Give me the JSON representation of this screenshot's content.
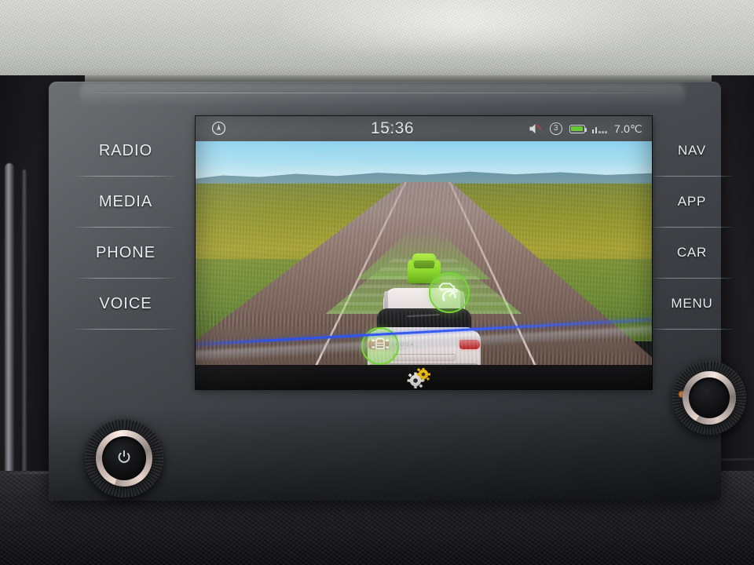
{
  "device": {
    "name": "Car infotainment head unit",
    "brand_hint": "Skoda"
  },
  "left_buttons": [
    {
      "label": "RADIO",
      "name": "radio"
    },
    {
      "label": "MEDIA",
      "name": "media"
    },
    {
      "label": "PHONE",
      "name": "phone"
    },
    {
      "label": "VOICE",
      "name": "voice"
    }
  ],
  "right_buttons": [
    {
      "label": "NAV",
      "name": "nav"
    },
    {
      "label": "APP",
      "name": "app"
    },
    {
      "label": "CAR",
      "name": "car"
    },
    {
      "label": "MENU",
      "name": "menu"
    }
  ],
  "statusbar": {
    "compass_icon": "compass-icon",
    "globe_icon": "globe-icon",
    "time": "15:36",
    "mute_icon": "speaker-mute-icon",
    "sim_label": "3",
    "battery_icon": "battery-full-icon",
    "signal_icon": "signal-bars-icon",
    "signal_bars": 2,
    "signal_dots": 3,
    "temperature": "7.0℃"
  },
  "screen": {
    "mode": "Driver assistance / Travel Assist view",
    "lead_vehicle_detected": true,
    "badges": [
      {
        "name": "adaptive-cruise-control-badge",
        "icon": "car-speedometer-icon",
        "state": "active",
        "color": "#76d634"
      },
      {
        "name": "lane-assist-badge",
        "icon": "car-lane-sensors-icon",
        "state": "active",
        "color": "#76d634"
      }
    ],
    "settings_icon": "gears-settings-icon",
    "gear_colors": {
      "primary": "#e8e6e2",
      "accent": "#f2c113"
    },
    "ego_vehicle_badge_text": "SKODA",
    "detection_cone_color": "#87e44e"
  },
  "knobs": [
    {
      "name": "power-volume-knob",
      "icon": "power-icon",
      "position": "left"
    },
    {
      "name": "tuning-knob",
      "icon": "none",
      "position": "right"
    }
  ],
  "colors": {
    "accent_green": "#76d634",
    "accent_blue": "#3a5ff5",
    "accent_yellow": "#f2c113",
    "screen_bg": "#1a1c1e",
    "statusbar_bg": "#565a5d",
    "bezel": "#45484c"
  }
}
